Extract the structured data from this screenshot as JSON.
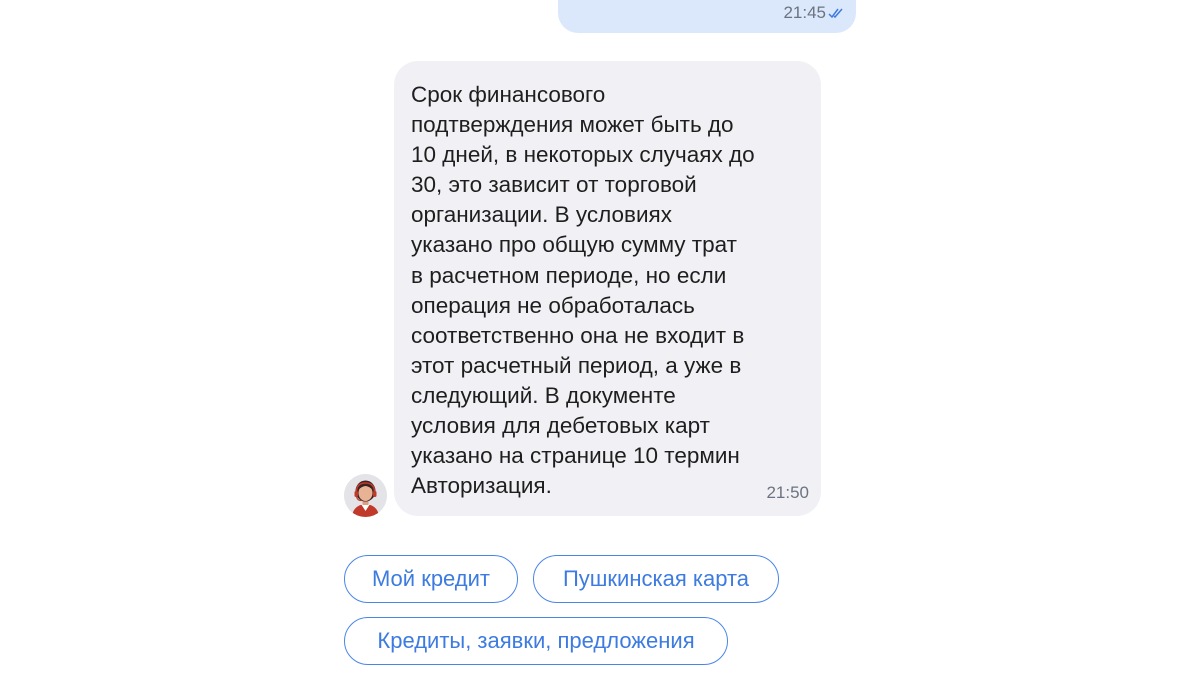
{
  "outgoing_message": {
    "time": "21:45",
    "status_icon": "double-check-icon",
    "bubble_color": "#dbe8fb"
  },
  "incoming_message": {
    "text": "Срок финансового подтверждения может быть до 10 дней, в некоторых случаях до 30, это зависит от торговой организации. В условиях указано про общую сумму трат в расчетном периоде, но если операция не обработалась соответственно она не входит в этот расчетный период, а уже в следующий. В документе условия для дебетовых карт указано на странице 10 термин Авторизация.",
    "lines": [
      "Срок финансового",
      "подтверждения может быть до",
      "10 дней, в некоторых случаях до",
      "30, это зависит от торговой",
      "организации. В условиях",
      "указано про общую сумму трат",
      "в расчетном периоде, но если",
      "операция не обработалась",
      "соответственно она не входит в",
      "этот расчетный период, а уже в",
      "следующий. В документе",
      "условия для дебетовых карт",
      "указано на странице 10 термин",
      "Авторизация."
    ],
    "time": "21:50",
    "bubble_color": "#f1f1f5",
    "avatar_icon": "operator-avatar-icon"
  },
  "quick_replies": [
    {
      "label": "Мой кредит"
    },
    {
      "label": "Пушкинская карта"
    },
    {
      "label": "Кредиты, заявки, предложения"
    }
  ],
  "colors": {
    "accent": "#3d7be0",
    "text": "#1e1e1e",
    "meta": "#6b7380"
  }
}
